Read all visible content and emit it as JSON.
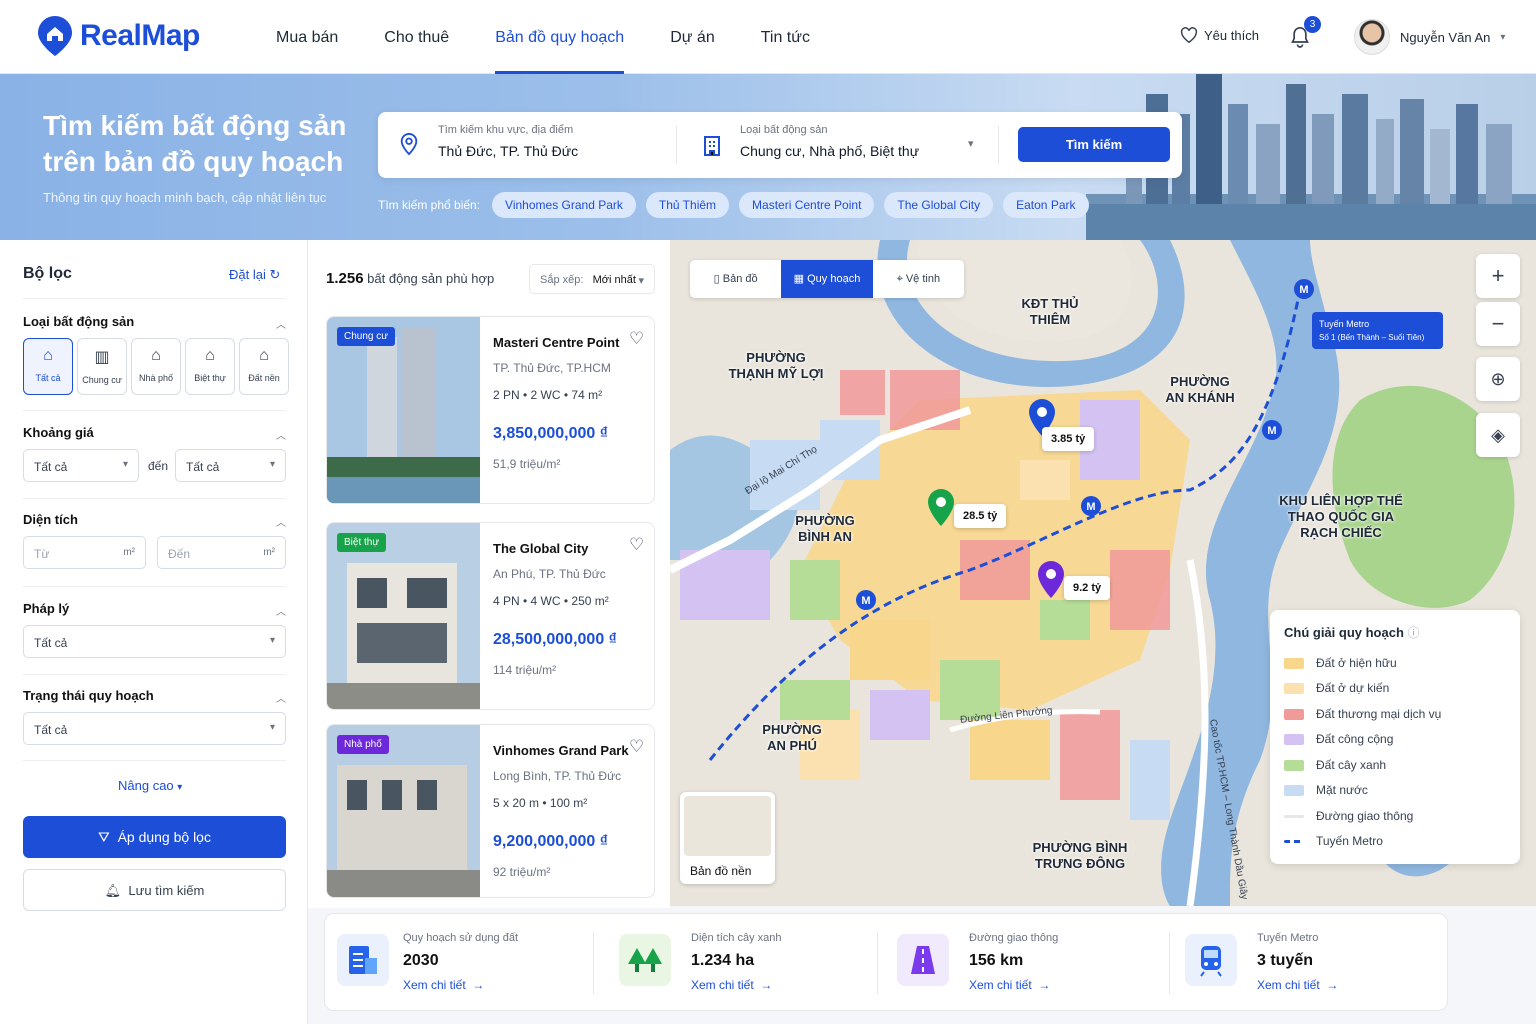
{
  "brand": {
    "name": "RealMap"
  },
  "nav": {
    "items": [
      "Mua bán",
      "Cho thuê",
      "Bản đồ quy hoạch",
      "Dự án",
      "Tin tức"
    ],
    "favorites": "Yêu thích",
    "notifications": "3",
    "user_name": "Nguyễn Văn An"
  },
  "hero": {
    "title": "Tìm kiếm bất động sản trên bản đồ quy hoạch",
    "subtitle": "Thông tin quy hoạch minh bạch, cập nhật liên tục",
    "location_label": "Tìm kiếm khu vực, địa điểm",
    "location_value": "Thủ Đức, TP. Thủ Đức",
    "type_label": "Loại bất động sản",
    "type_value": "Chung cư, Nhà phố, Biệt thự",
    "search_button": "Tìm kiếm",
    "popular_label": "Tìm kiếm phổ biến:",
    "popular": [
      "Vinhomes Grand Park",
      "Thủ Thiêm",
      "Masteri Centre Point",
      "The Global City",
      "Eaton Park"
    ]
  },
  "filter": {
    "title": "Bộ lọc",
    "reset": "Đặt lại",
    "type_section": "Loại bất động sản",
    "types": [
      "Tất cả",
      "Chung cư",
      "Nhà phố",
      "Biệt thự",
      "Đất nền"
    ],
    "price_section": "Khoảng giá",
    "price_from": "Tất cả",
    "price_to_label": "đến",
    "price_to": "Tất cả",
    "area_section": "Diện tích",
    "area_from_placeholder": "Từ",
    "area_to_placeholder": "Đến",
    "area_unit": "m²",
    "legal_section": "Pháp lý",
    "legal_value": "Tất cả",
    "status_section": "Trạng thái quy hoạch",
    "status_value": "Tất cả",
    "advanced": "Nâng cao",
    "apply": "Áp dụng bộ lọc",
    "save": "Lưu tìm kiếm"
  },
  "results": {
    "count": "1.256",
    "count_label": "bất động sản phù hợp",
    "sort_label": "Sắp xếp:",
    "sort_value": "Mới nhất",
    "listings": [
      {
        "tag": "Chung cư",
        "tag_color": "#1d4ed8",
        "name": "Masteri Centre Point",
        "location": "TP. Thủ Đức, TP.HCM",
        "specs": "2 PN  •  2 WC  •  74 m²",
        "price": "3,850,000,000 ₫",
        "unit_price": "51,9 triệu/m²"
      },
      {
        "tag": "Biệt thự",
        "tag_color": "#16a34a",
        "name": "The Global City",
        "location": "An Phú, TP. Thủ Đức",
        "specs": "4 PN  •  4 WC  •  250 m²",
        "price": "28,500,000,000 ₫",
        "unit_price": "114 triệu/m²"
      },
      {
        "tag": "Nhà phố",
        "tag_color": "#6d28d9",
        "name": "Vinhomes Grand Park",
        "location": "Long Bình, TP. Thủ Đức",
        "specs": "5 x 20 m  •  100 m²",
        "price": "9,200,000,000 ₫",
        "unit_price": "92 triệu/m²"
      }
    ]
  },
  "map": {
    "tabs": [
      "Bản đồ",
      "Quy hoạch",
      "Vệ tinh"
    ],
    "metro_title": "Tuyến Metro",
    "metro_sub": "Số 1 (Bến Thành – Suối Tiên)",
    "pins": [
      {
        "label": "3.85 tỷ",
        "color": "#1d4ed8"
      },
      {
        "label": "28.5 tỷ",
        "color": "#16a34a"
      },
      {
        "label": "9.2 tỷ",
        "color": "#6d28d9"
      }
    ],
    "places": [
      "KĐT THỦ THIÊM",
      "PHƯỜNG THẠNH MỸ LỢI",
      "PHƯỜNG AN KHÁNH",
      "PHƯỜNG BÌNH AN",
      "KHU LIÊN HỢP THỂ THAO QUỐC GIA RẠCH CHIẾC",
      "PHƯỜNG AN PHÚ",
      "PHƯỜNG BÌNH TRƯNG ĐÔNG"
    ],
    "roads": [
      "Đại lộ Mai Chí Thọ",
      "Đường Liên Phường",
      "Cao tốc TP.HCM – Long Thành Dầu Giây"
    ],
    "base_map": "Bản đồ nền",
    "legend_title": "Chú giải quy hoạch",
    "legend": [
      {
        "label": "Đất ở hiện hữu",
        "color": "#f8d68c"
      },
      {
        "label": "Đất ở dự kiến",
        "color": "#fbe1b0"
      },
      {
        "label": "Đất thương mại dịch vụ",
        "color": "#f19a9a"
      },
      {
        "label": "Đất công cộng",
        "color": "#d3c2f2"
      },
      {
        "label": "Đất cây xanh",
        "color": "#b6dd97"
      },
      {
        "label": "Mặt nước",
        "color": "#c7dcf2"
      },
      {
        "label": "Đường giao thông",
        "color": "#e5e7eb"
      },
      {
        "label": "Tuyến Metro",
        "color": "#1d4ed8"
      }
    ]
  },
  "stats": [
    {
      "label": "Quy hoạch sử dụng đất",
      "value": "2030",
      "link": "Xem chi tiết"
    },
    {
      "label": "Diện tích cây xanh",
      "value": "1.234 ha",
      "link": "Xem chi tiết"
    },
    {
      "label": "Đường giao thông",
      "value": "156 km",
      "link": "Xem chi tiết"
    },
    {
      "label": "Tuyến Metro",
      "value": "3 tuyến",
      "link": "Xem chi tiết"
    }
  ]
}
